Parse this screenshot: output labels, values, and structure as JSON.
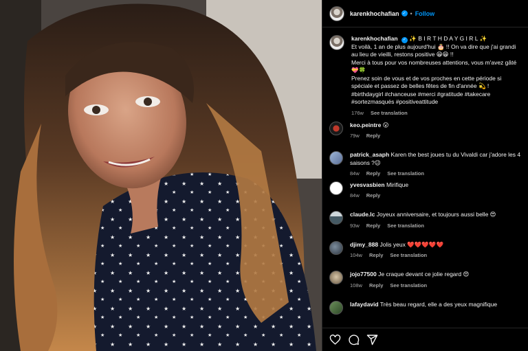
{
  "post": {
    "username": "karenkhochafian",
    "separator": "•",
    "follow_label": "Follow",
    "caption_lines": [
      "✨ B I R T H D A Y G I R L ✨",
      "Et voilà, 1 an de plus aujourd'hui 🎂 !! On va dire que j'ai grandi au lieu de vieilli, restons positive 😁😁 !!",
      "Merci à tous pour vos nombreuses attentions, vous m'avez gâté 💝🍀",
      "Prenez soin de vous et de vos proches en cette période si spéciale et passez de belles fêtes de fin d'année 💫 !",
      "#birthdaygirl #chanceuse #merci #gratitude #takecare #sortezmasqués #positiveattitude"
    ],
    "caption_time": "176w",
    "see_translation": "See translation"
  },
  "comments": [
    {
      "user": "keo.peintre",
      "text": "😮",
      "time": "79w",
      "reply": "Reply",
      "translation": ""
    },
    {
      "user": "patrick_asaph",
      "text": "Karen the best joues tu du Vivaldi car j'adore les 4 saisons ?😉",
      "time": "84w",
      "reply": "Reply",
      "translation": "See translation"
    },
    {
      "user": "yvesvasbien",
      "text": "Mirifique",
      "time": "84w",
      "reply": "Reply",
      "translation": ""
    },
    {
      "user": "claude.lc",
      "text": "Joyeux anniversaire, et toujours aussi belle 😍",
      "time": "93w",
      "reply": "Reply",
      "translation": "See translation"
    },
    {
      "user": "djimy_888",
      "text": "Jolis yeux ❤️❤️❤️❤️❤️",
      "time": "104w",
      "reply": "Reply",
      "translation": "See translation"
    },
    {
      "user": "jojo77500",
      "text": "Je craque devant ce jolie regard 😍",
      "time": "108w",
      "reply": "Reply",
      "translation": "See translation"
    },
    {
      "user": "lafaydavid",
      "text": "Très beau regard, elle a des yeux magnifique",
      "time": "",
      "reply": "",
      "translation": ""
    }
  ],
  "icons": [
    "heart-icon",
    "comment-icon",
    "share-icon",
    "verified-icon"
  ],
  "colors": {
    "accent": "#0095f6",
    "background": "#000000",
    "muted": "#a8a8a8"
  }
}
